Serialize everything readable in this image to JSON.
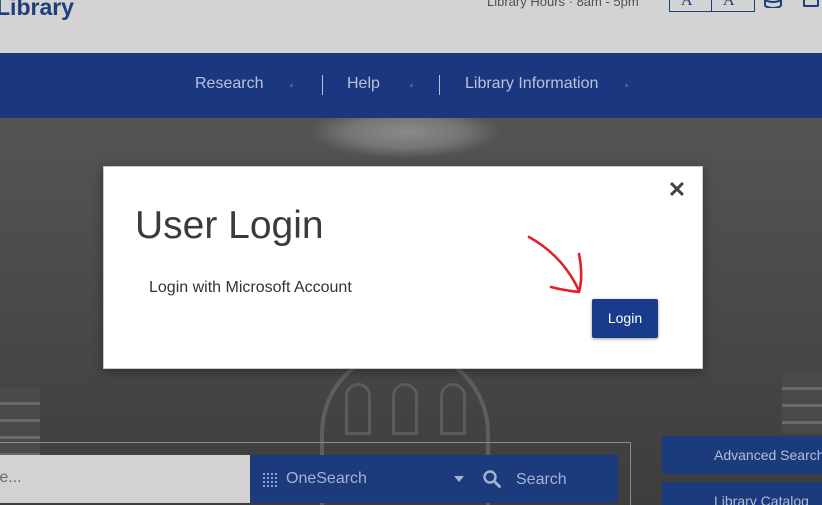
{
  "header": {
    "brand": "Library",
    "hours": "Library Hours · 8am - 5pm",
    "font_larger": "A⁺",
    "font_smaller": "A⁻"
  },
  "nav": {
    "items": [
      {
        "label": "Research"
      },
      {
        "label": "Help"
      },
      {
        "label": "Library Information"
      }
    ]
  },
  "search": {
    "placeholder": "re...",
    "scope": "OneSearch",
    "button_label": "Search"
  },
  "side_links": [
    {
      "label": "Advanced Search"
    },
    {
      "label": "Library Catalog"
    }
  ],
  "modal": {
    "title": "User Login",
    "subtitle": "Login with Microsoft Account",
    "close": "✕",
    "login_label": "Login"
  },
  "colors": {
    "brand": "#1e3d7b",
    "nav_bg": "#1b3780",
    "login_button": "#1a3a8c",
    "annotation_arrow": "#e0202a"
  },
  "icons": [
    "database-icon",
    "bag-icon",
    "grid-icon",
    "search-icon",
    "close-icon",
    "arrow-annotation"
  ]
}
